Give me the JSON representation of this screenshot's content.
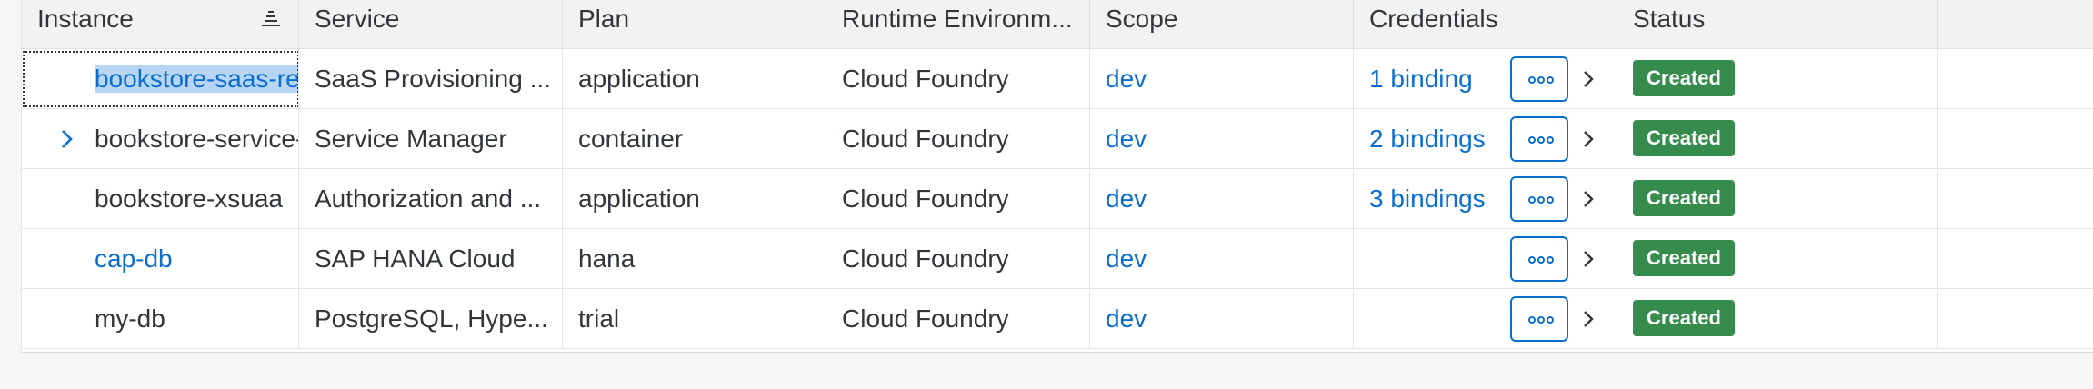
{
  "columns": {
    "instance": "Instance",
    "service": "Service",
    "plan": "Plan",
    "runtime": "Runtime Environm...",
    "scope": "Scope",
    "credentials": "Credentials",
    "status": "Status"
  },
  "rows": [
    {
      "instance": "bookstore-saas-registry",
      "service": "SaaS Provisioning ...",
      "plan": "application",
      "runtime": "Cloud Foundry",
      "scope": "dev",
      "credentials": "1 binding",
      "status": "Created"
    },
    {
      "instance": "bookstore-service-manager",
      "service": "Service Manager",
      "plan": "container",
      "runtime": "Cloud Foundry",
      "scope": "dev",
      "credentials": "2 bindings",
      "status": "Created"
    },
    {
      "instance": "bookstore-xsuaa",
      "service": "Authorization and ...",
      "plan": "application",
      "runtime": "Cloud Foundry",
      "scope": "dev",
      "credentials": "3 bindings",
      "status": "Created"
    },
    {
      "instance": "cap-db",
      "service": "SAP HANA Cloud",
      "plan": "hana",
      "runtime": "Cloud Foundry",
      "scope": "dev",
      "credentials": "",
      "status": "Created"
    },
    {
      "instance": "my-db",
      "service": "PostgreSQL, Hype...",
      "plan": "trial",
      "runtime": "Cloud Foundry",
      "scope": "dev",
      "credentials": "",
      "status": "Created"
    }
  ],
  "colors": {
    "link": "#0a6ed1",
    "status_created": "#368c4d",
    "header_bg": "#f2f2f2"
  },
  "icons": {
    "sort": "sort-descending-icon",
    "info": "info-icon",
    "expand": "chevron-right-icon",
    "actions": "overflow-dots-icon",
    "navigate": "chevron-right-icon"
  }
}
